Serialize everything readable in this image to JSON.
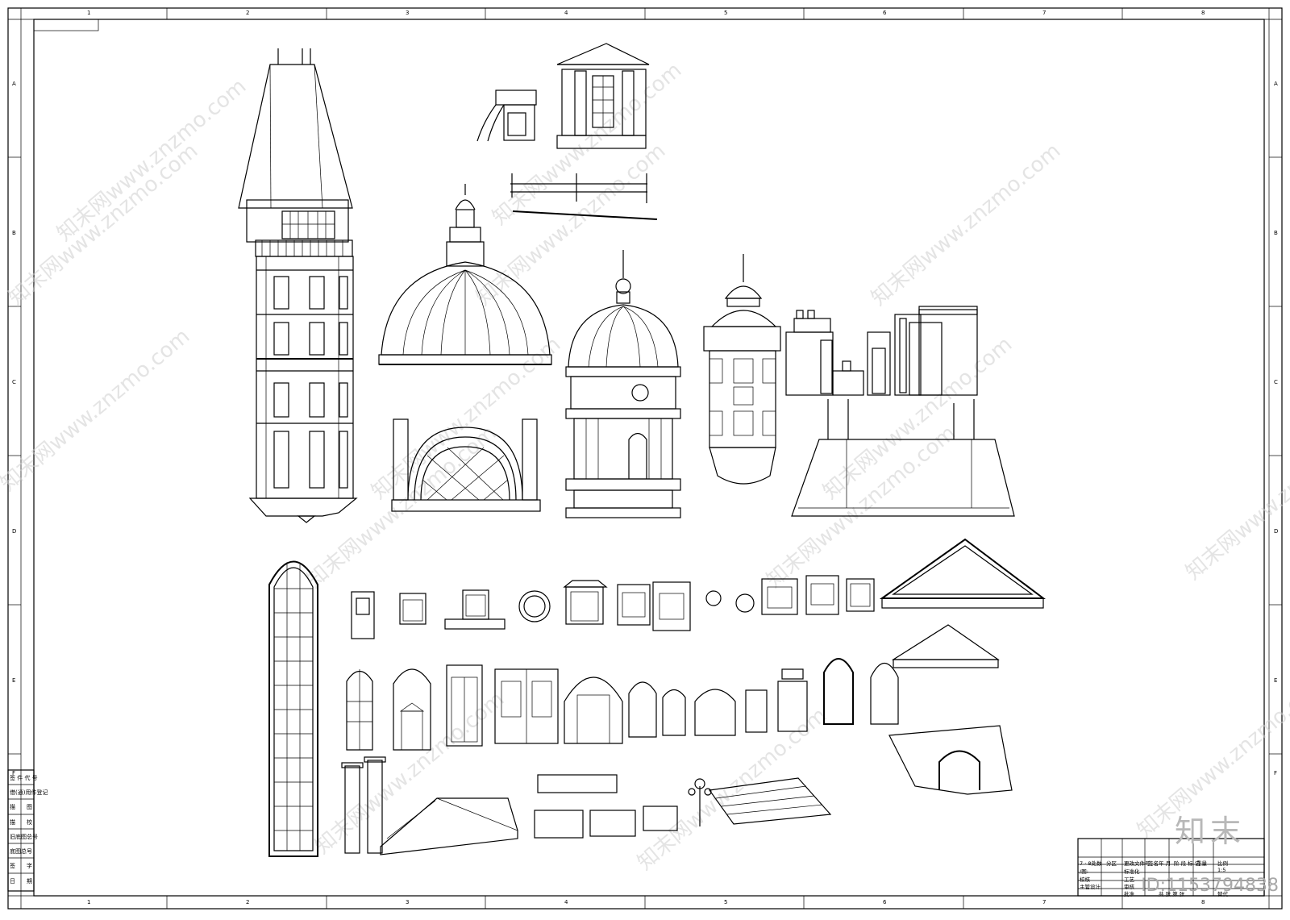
{
  "sheet": {
    "columns": [
      "1",
      "2",
      "3",
      "4",
      "5",
      "6",
      "7",
      "8"
    ],
    "rows": [
      "A",
      "B",
      "C",
      "D",
      "E",
      "F"
    ]
  },
  "watermark": {
    "text": "知末网www.znzmo.com",
    "brand": "知末",
    "id_label": "ID:1153794838"
  },
  "left_stamp": {
    "rows": [
      "签 件 代 号",
      "借(通)用件登记",
      "描　　图",
      "描　　校",
      "旧底图总号",
      "底图总号",
      "签　　字",
      "日　　期"
    ]
  },
  "title_block": {
    "cells": [
      "7 · 8处数",
      "分区",
      "更改文件号",
      "签名",
      "年 月",
      "阶 段 标 记",
      "重量",
      "比例",
      "/图:",
      "标准化",
      "1:5",
      "校核",
      "工艺",
      "主管设计",
      "审核",
      "批准",
      "共 张 第 张",
      "替代"
    ]
  }
}
